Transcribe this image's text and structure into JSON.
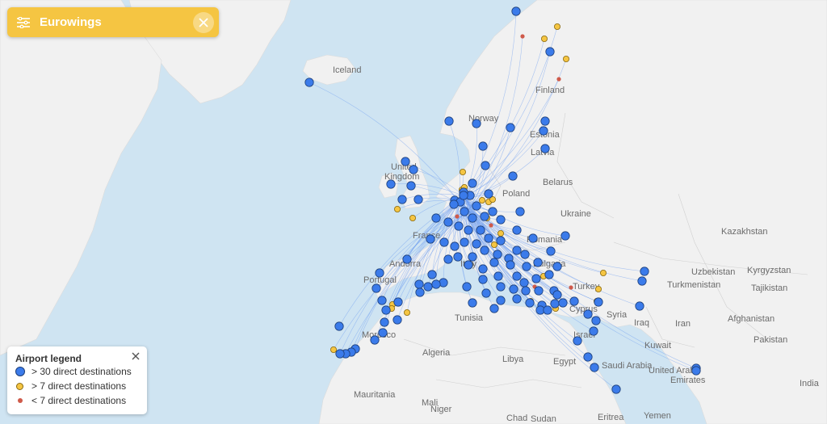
{
  "airline": {
    "name": "Eurowings",
    "filter_icon": "sliders-icon",
    "close_icon": "close-icon"
  },
  "legend": {
    "title": "Airport legend",
    "close_icon": "close-icon",
    "items": [
      {
        "label": "> 30 direct destinations",
        "color": "#3b7bea",
        "size": "large"
      },
      {
        "label": "> 7 direct destinations",
        "color": "#f5c542",
        "size": "medium"
      },
      {
        "label": "< 7 direct destinations",
        "color": "#cf5a4a",
        "size": "small"
      }
    ]
  },
  "colors": {
    "water": "#cfe4f2",
    "land": "#f1f1f1",
    "route": "#6f9ff0",
    "accent": "#f5c542"
  },
  "country_labels": [
    "Iceland",
    "Norway",
    "Finland",
    "Estonia",
    "Latvia",
    "United",
    "Kingdom",
    "Belarus",
    "Poland",
    "Ukraine",
    "France",
    "Romania",
    "Bulgaria",
    "Andorra",
    "Portugal",
    "Italy",
    "Turkey",
    "Uzbekistan",
    "Kyrgyzstan",
    "Tajikistan",
    "Turkmenistan",
    "Kazakhstan",
    "Cyprus",
    "Syria",
    "Israel",
    "Iraq",
    "Kuwait",
    "Iran",
    "Afghanistan",
    "Pakistan",
    "India",
    "Tunisia",
    "Morocco",
    "Algeria",
    "Libya",
    "Egypt",
    "Saudi Arabia",
    "United Arab",
    "Emirates",
    "Mauritania",
    "Mali",
    "Niger",
    "Chad",
    "Eritrea",
    "Yemen",
    "Sudan"
  ]
}
